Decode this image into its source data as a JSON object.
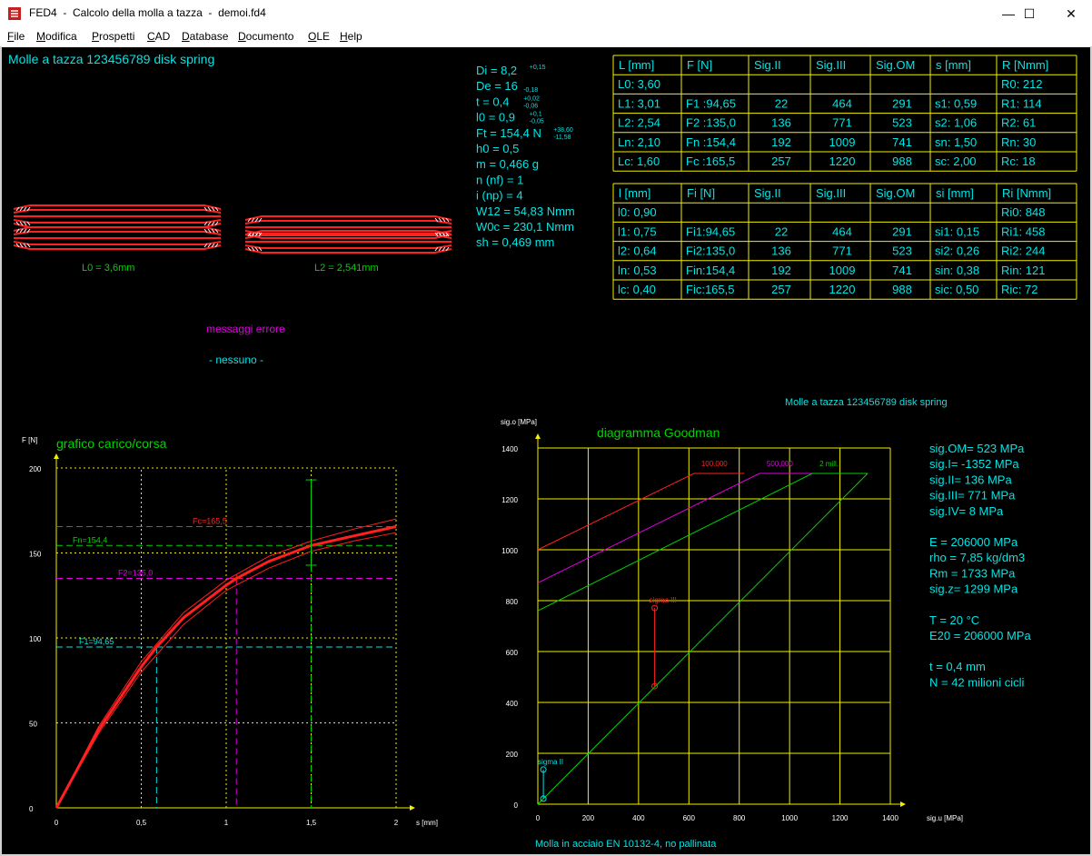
{
  "window": {
    "title": "FED4  -  Calcolo della molla a tazza  -  demoi.fd4",
    "minimize": "—",
    "maximize": "☐",
    "close": "✕"
  },
  "menu": [
    {
      "label": "File",
      "key": "F",
      "rest": "ile"
    },
    {
      "label": "Modifica",
      "key": "M",
      "rest": "odifica"
    },
    {
      "label": "Prospetti",
      "key": "P",
      "rest": "rospetti"
    },
    {
      "label": "CAD",
      "key": "C",
      "rest": "AD"
    },
    {
      "label": "Database",
      "key": "D",
      "rest": "atabase"
    },
    {
      "label": "Documento",
      "key": "D",
      "rest": "ocumento"
    },
    {
      "label": "OLE",
      "key": "O",
      "rest": "LE"
    },
    {
      "label": "Help",
      "key": "H",
      "rest": "elp"
    }
  ],
  "header_title": "Molle a tazza  123456789  disk spring",
  "params": [
    {
      "text": "Di = 8,2",
      "tol_up": "+0,15",
      "tol_dn": ""
    },
    {
      "text": "De = 16",
      "tol_up": "",
      "tol_dn": "-0,18"
    },
    {
      "text": "t = 0,4",
      "tol_up": "+0,02",
      "tol_dn": "-0,06"
    },
    {
      "text": "l0 = 0,9",
      "tol_up": "+0,1",
      "tol_dn": "-0,05"
    },
    {
      "text": "Ft = 154,4 N",
      "tol_up": "+38,60",
      "tol_dn": "-11,58"
    },
    {
      "text": "h0 = 0,5",
      "tol_up": "",
      "tol_dn": ""
    },
    {
      "text": "m = 0,466 g",
      "tol_up": "",
      "tol_dn": ""
    },
    {
      "text": "n (nf) = 1",
      "tol_up": "",
      "tol_dn": ""
    },
    {
      "text": "i (np) = 4",
      "tol_up": "",
      "tol_dn": ""
    },
    {
      "text": "W12 = 54,83 Nmm",
      "tol_up": "",
      "tol_dn": ""
    },
    {
      "text": "W0c = 230,1 Nmm",
      "tol_up": "",
      "tol_dn": ""
    },
    {
      "text": "sh = 0,469 mm",
      "tol_up": "",
      "tol_dn": ""
    }
  ],
  "table1": {
    "headers": [
      "L [mm]",
      "F [N]",
      "Sig.II",
      "Sig.III",
      "Sig.OM",
      "s [mm]",
      "R [Nmm]"
    ],
    "rows": [
      [
        "L0:   3,60",
        "",
        "",
        "",
        "",
        "",
        "R0:    212"
      ],
      [
        "L1:   3,01",
        "F1 :94,65",
        "22",
        "464",
        "291",
        "s1:   0,59",
        "R1:    114"
      ],
      [
        "L2:   2,54",
        "F2 :135,0",
        "136",
        "771",
        "523",
        "s2:   1,06",
        "R2:     61"
      ],
      [
        "Ln:   2,10",
        "Fn :154,4",
        "192",
        "1009",
        "741",
        "sn:   1,50",
        "Rn:     30"
      ],
      [
        "Lc:   1,60",
        "Fc :165,5",
        "257",
        "1220",
        "988",
        "sc:   2,00",
        "Rc:     18"
      ]
    ]
  },
  "table2": {
    "headers": [
      "l [mm]",
      "Fi [N]",
      "Sig.II",
      "Sig.III",
      "Sig.OM",
      "si [mm]",
      "Ri [Nmm]"
    ],
    "rows": [
      [
        "l0:   0,90",
        "",
        "",
        "",
        "",
        "",
        "Ri0:    848"
      ],
      [
        "l1:   0,75",
        "Fi1:94,65",
        "22",
        "464",
        "291",
        "si1:   0,15",
        "Ri1:    458"
      ],
      [
        "l2:   0,64",
        "Fi2:135,0",
        "136",
        "771",
        "523",
        "si2:   0,26",
        "Ri2:    244"
      ],
      [
        "ln:   0,53",
        "Fin:154,4",
        "192",
        "1009",
        "741",
        "sin:   0,38",
        "Rin:    121"
      ],
      [
        "lc:   0,40",
        "Fic:165,5",
        "257",
        "1220",
        "988",
        "sic:   0,50",
        "Ric:     72"
      ]
    ]
  },
  "stack_labels": [
    "L0 = 3,6mm",
    "L2 = 2,541mm"
  ],
  "messages": {
    "title": "messaggi errore",
    "text": "- nessuno -"
  },
  "goodman_header": "Molle a tazza  123456789  disk spring",
  "side_info": [
    [
      "sig.OM=  523 MPa",
      "sig.I= -1352 MPa",
      "sig.II=  136 MPa",
      "sig.III=  771 MPa",
      "sig.IV=    8 MPa"
    ],
    [
      "E = 206000 MPa",
      "rho =  7,85 kg/dm3",
      "Rm = 1733 MPa",
      "sig.z= 1299 MPa"
    ],
    [
      "T =  20 °C",
      "E20 = 206000 MPa"
    ],
    [
      "t  = 0,4 mm",
      "N = 42 milioni cicli"
    ]
  ],
  "footer_note": "Molla in acciaio EN 10132-4, no pallinata",
  "colors": {
    "background": "#000000",
    "cyan": "#00e5e5",
    "green": "#00d400",
    "yellow": "#f0f000",
    "red": "#ff2020",
    "magenta": "#e000e0"
  },
  "chart_data": [
    {
      "type": "line",
      "title": "grafico carico/corsa",
      "xlabel": "s [mm]",
      "ylabel": "F [N]",
      "xlim": [
        0,
        2
      ],
      "ylim": [
        0,
        200
      ],
      "x_ticks": [
        "0",
        "0,5",
        "1",
        "1,5",
        "2"
      ],
      "y_ticks": [
        "0",
        "50",
        "100",
        "150",
        "200"
      ],
      "series": [
        {
          "x": [
            0,
            0.25,
            0.5,
            0.59,
            0.75,
            1.0,
            1.06,
            1.25,
            1.5,
            1.75,
            2.0
          ],
          "y": [
            0,
            46,
            83,
            94.65,
            112,
            131,
            135,
            145,
            154.4,
            160,
            165.5
          ]
        },
        {
          "x": [
            0,
            0.25,
            0.5,
            0.75,
            1.0,
            1.25,
            1.5,
            1.75,
            2.0
          ],
          "y": [
            0,
            48,
            86,
            115,
            134,
            148,
            157,
            164,
            170
          ]
        },
        {
          "x": [
            0,
            0.25,
            0.5,
            0.75,
            1.0,
            1.25,
            1.5,
            1.75,
            2.0
          ],
          "y": [
            0,
            44,
            80,
            108,
            128,
            141,
            151,
            157,
            162
          ]
        }
      ],
      "annotations": [
        {
          "label": "Fc=165,5",
          "s": 2.0,
          "F": 165.5,
          "color": "#ff2020"
        },
        {
          "label": "Fn=154,4",
          "s": 1.5,
          "F": 154.4,
          "color": "#00d400"
        },
        {
          "label": "F2=135,0",
          "s": 1.06,
          "F": 135.0,
          "color": "#e000e0"
        },
        {
          "label": "F1=94,65",
          "s": 0.59,
          "F": 94.65,
          "color": "#00e5e5"
        }
      ],
      "tolerance_bar": {
        "s": 1.5,
        "F_min": 142.8,
        "F_max": 193.0
      }
    },
    {
      "type": "line",
      "title": "diagramma Goodman",
      "xlabel": "sig.u [MPa]",
      "ylabel": "sig.o [MPa]",
      "xlim": [
        0,
        1400
      ],
      "ylim": [
        0,
        1400
      ],
      "x_ticks": [
        "0",
        "200",
        "400",
        "600",
        "800",
        "1000",
        "1200",
        "1400"
      ],
      "y_ticks": [
        "0",
        "200",
        "400",
        "600",
        "800",
        "1000",
        "1200",
        "1400"
      ],
      "series": [
        {
          "name": "100.000",
          "x": [
            0,
            620,
            820
          ],
          "y": [
            1000,
            1300,
            1300
          ],
          "color": "#ff2020"
        },
        {
          "name": "500.000",
          "x": [
            0,
            880,
            1090
          ],
          "y": [
            870,
            1300,
            1300
          ],
          "color": "#e000e0"
        },
        {
          "name": "2 mill.",
          "x": [
            0,
            1090,
            1310
          ],
          "y": [
            760,
            1300,
            1300
          ],
          "color": "#00d400"
        },
        {
          "x": [
            0,
            1310
          ],
          "y": [
            0,
            1300
          ],
          "color": "#00d400"
        }
      ],
      "points": [
        {
          "label": "sigma III",
          "x": 464,
          "y": 464,
          "x2": 464,
          "y2": 771,
          "color": "#ff2020"
        },
        {
          "label": "sigma II",
          "x": 22,
          "y": 22,
          "x2": 22,
          "y2": 136,
          "color": "#00e5e5"
        }
      ]
    }
  ]
}
